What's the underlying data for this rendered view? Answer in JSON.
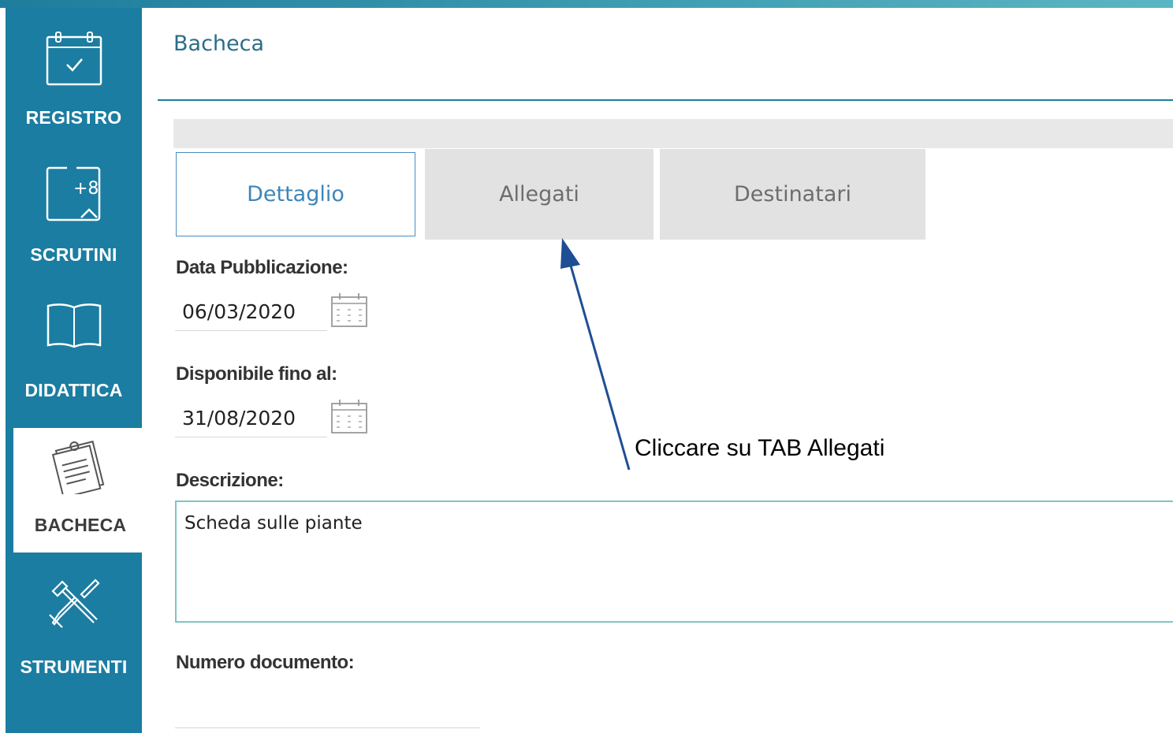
{
  "sidebar": {
    "items": [
      {
        "label": "REGISTRO",
        "icon": "calendar-check-icon"
      },
      {
        "label": "SCRUTINI",
        "icon": "scrutini-icon"
      },
      {
        "label": "DIDATTICA",
        "icon": "book-icon"
      },
      {
        "label": "BACHECA",
        "icon": "notepad-icon",
        "active": true
      },
      {
        "label": "STRUMENTI",
        "icon": "tools-icon"
      }
    ]
  },
  "header": {
    "title": "Bacheca"
  },
  "tabs": [
    {
      "label": "Dettaglio",
      "active": true
    },
    {
      "label": "Allegati"
    },
    {
      "label": "Destinatari"
    }
  ],
  "form": {
    "data_pubblicazione_label": "Data Pubblicazione:",
    "data_pubblicazione_value": "06/03/2020",
    "disponibile_label": "Disponibile fino al:",
    "disponibile_value": "31/08/2020",
    "descrizione_label": "Descrizione:",
    "descrizione_value": "Scheda sulle piante",
    "numero_label": "Numero documento:",
    "numero_value": ""
  },
  "annotation": {
    "text": "Cliccare su TAB Allegati"
  },
  "colors": {
    "sidebar": "#1b7da1",
    "accent": "#3e86b8",
    "arrow": "#1f4e95"
  }
}
